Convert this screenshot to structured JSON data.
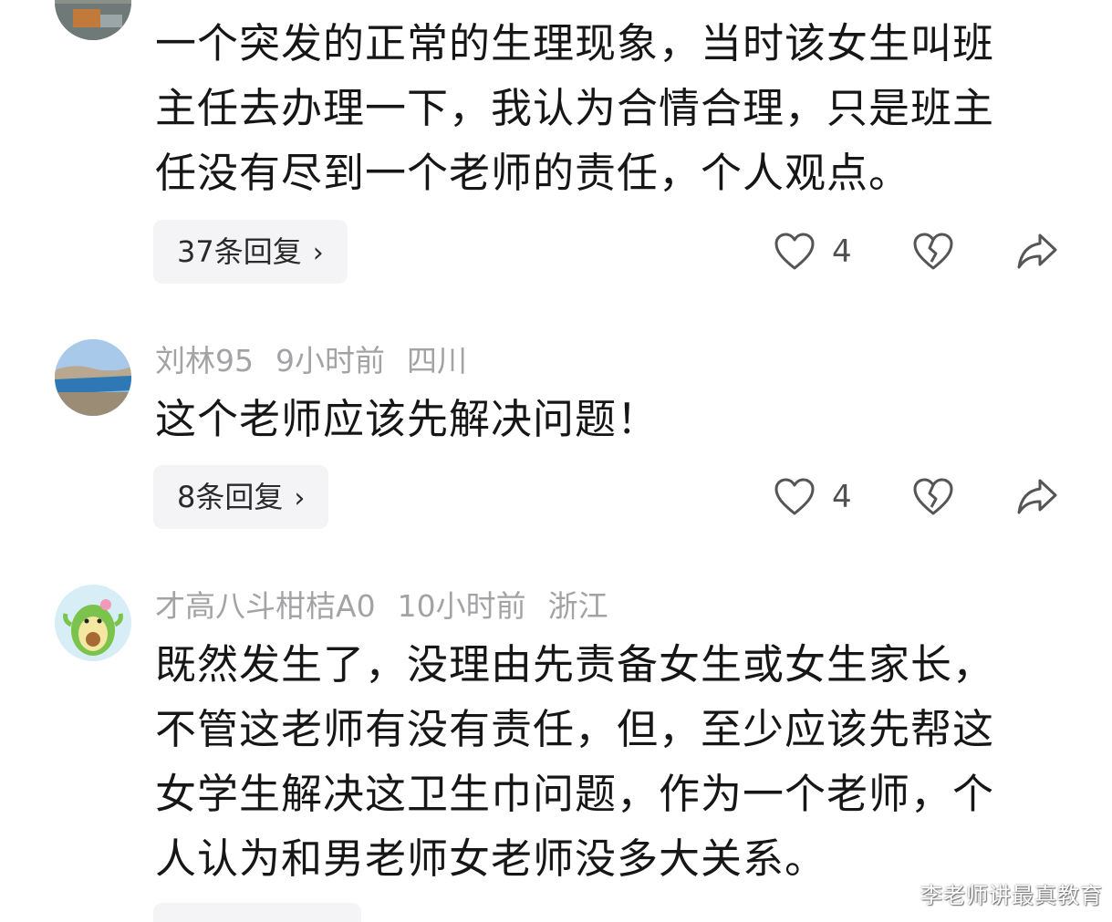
{
  "comments": [
    {
      "text_lines": [
        "一个突发的正常的生理现象，当时该女生叫班",
        "主任去办理一下，我认为合情合理，只是班主",
        "任没有尽到一个老师的责任，个人观点。"
      ],
      "replies_label": "37条回复",
      "likes": "4"
    },
    {
      "username": "刘林95",
      "time": "9小时前",
      "location": "四川",
      "text_lines": [
        "这个老师应该先解决问题！"
      ],
      "replies_label": "8条回复",
      "likes": "4"
    },
    {
      "username": "才高八斗柑桔A0",
      "time": "10小时前",
      "location": "浙江",
      "text_lines": [
        "既然发生了，没理由先责备女生或女生家长，",
        "不管这老师有没有责任，但，至少应该先帮这",
        "女学生解决这卫生巾问题，作为一个老师，个",
        "人认为和男老师女老师没多大关系。"
      ]
    }
  ],
  "icons": {
    "like": "heart-outline-icon",
    "dislike": "broken-heart-icon",
    "share": "share-arrow-icon",
    "chevron": "chevron-right-icon"
  },
  "chevron_glyph": "›",
  "watermark": "李老师讲最真教育",
  "colors": {
    "meta_text": "#a3a3a6",
    "body_text": "#161616",
    "reply_bg": "#f4f4f6",
    "icon_stroke": "#555555"
  }
}
